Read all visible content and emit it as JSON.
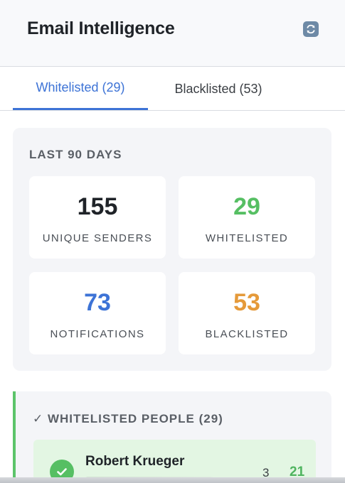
{
  "header": {
    "title": "Email Intelligence",
    "refresh_icon": "refresh-icon"
  },
  "tabs": [
    {
      "label": "Whitelisted (29)",
      "active": true
    },
    {
      "label": "Blacklisted (53)",
      "active": false
    }
  ],
  "stats": {
    "heading": "LAST 90 DAYS",
    "cards": [
      {
        "value": "155",
        "label": "UNIQUE SENDERS",
        "color": "#1f2328"
      },
      {
        "value": "29",
        "label": "WHITELISTED",
        "color": "#56bf63"
      },
      {
        "value": "73",
        "label": "NOTIFICATIONS",
        "color": "#3d73d6"
      },
      {
        "value": "53",
        "label": "BLACKLISTED",
        "color": "#e59a3a"
      }
    ]
  },
  "people": {
    "heading": "✓ WHITELISTED PEOPLE (29)",
    "rows": [
      {
        "name": "Robert Krueger",
        "count_a": "3",
        "count_b": "21",
        "icon": "check-circle-icon"
      }
    ]
  },
  "colors": {
    "accent": "#3d73d6",
    "whitelist": "#56bf63",
    "blacklist": "#e59a3a"
  }
}
